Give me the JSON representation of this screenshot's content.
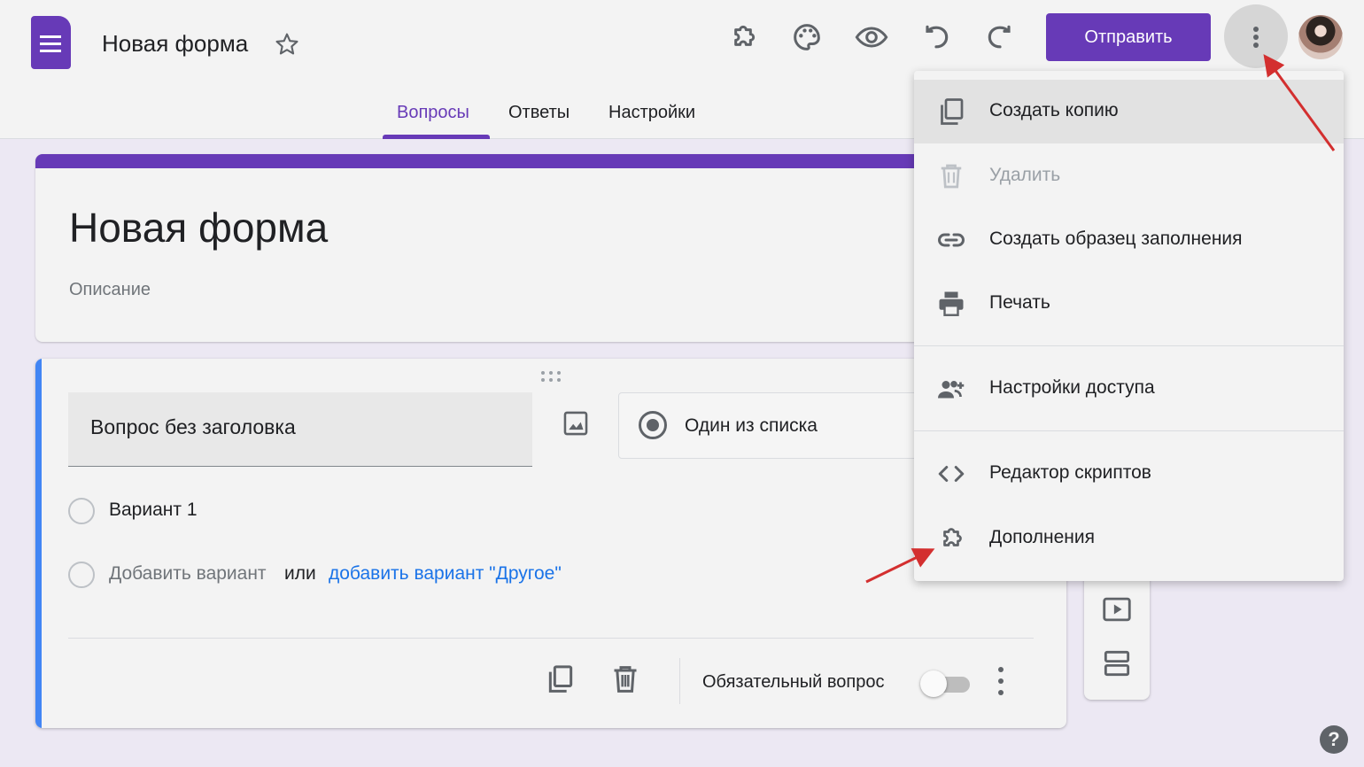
{
  "header": {
    "title": "Новая форма",
    "send_label": "Отправить",
    "tabs": [
      {
        "label": "Вопросы",
        "active": true
      },
      {
        "label": "Ответы",
        "active": false
      },
      {
        "label": "Настройки",
        "active": false
      }
    ],
    "toolbar_icons": [
      "addons-icon",
      "palette-icon",
      "preview-eye-icon",
      "undo-icon",
      "redo-icon"
    ]
  },
  "form": {
    "title": "Новая форма",
    "description_placeholder": "Описание"
  },
  "question": {
    "title": "Вопрос без заголовка",
    "type": "Один из списка",
    "option1": "Вариант 1",
    "add_option": "Добавить вариант",
    "or": "или",
    "add_other": "добавить вариант \"Другое\"",
    "required_label": "Обязательный вопрос",
    "required": false
  },
  "menu": {
    "items": [
      {
        "label": "Создать копию",
        "icon": "copy-icon",
        "disabled": false
      },
      {
        "label": "Удалить",
        "icon": "trash-icon",
        "disabled": true
      },
      {
        "label": "Создать образец заполнения",
        "icon": "link-icon",
        "disabled": false
      },
      {
        "label": "Печать",
        "icon": "print-icon",
        "disabled": false
      },
      {
        "label": "Настройки доступа",
        "icon": "share-people-icon",
        "disabled": false
      },
      {
        "label": "Редактор скриптов",
        "icon": "code-icon",
        "disabled": false
      },
      {
        "label": "Дополнения",
        "icon": "addons-icon",
        "disabled": false
      }
    ]
  },
  "help_label": "?",
  "colors": {
    "brand": "#673ab7",
    "question_accent": "#4285f4",
    "link": "#1a73e8",
    "annotation_arrow": "#d32f2f"
  }
}
